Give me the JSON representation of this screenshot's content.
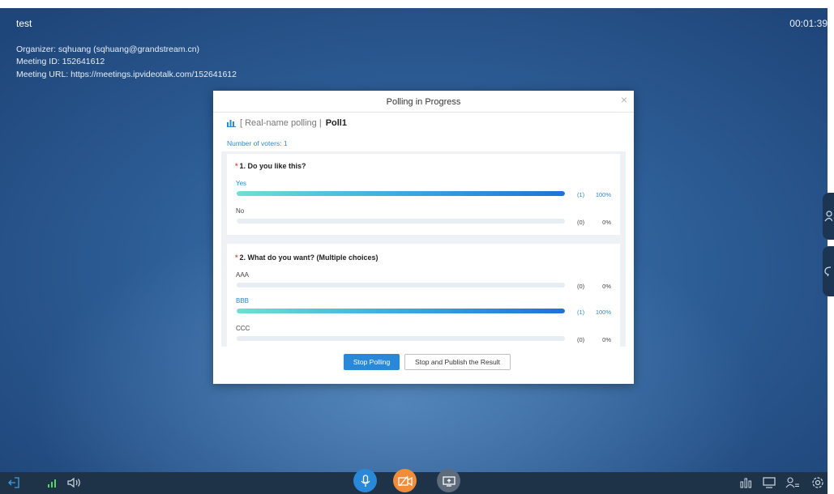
{
  "meeting": {
    "title": "test",
    "timer": "00:01:39",
    "organizer": "Organizer: sqhuang (sqhuang@grandstream.cn)",
    "meeting_id": "Meeting ID: 152641612",
    "meeting_url": "Meeting URL: https://meetings.ipvideotalk.com/152641612"
  },
  "dialog": {
    "title": "Polling in Progress",
    "close_symbol": "×",
    "poll_type": "[ Real-name polling |",
    "poll_name": "Poll1",
    "voters_text": "Number of voters: 1",
    "questions": [
      {
        "required_mark": "*",
        "title": "1. Do you like this?",
        "options": [
          {
            "label": "Yes",
            "count": "(1)",
            "percent": "100%",
            "fraction": 1.0,
            "selected": true
          },
          {
            "label": "No",
            "count": "(0)",
            "percent": "0%",
            "fraction": 0.0,
            "selected": false
          }
        ]
      },
      {
        "required_mark": "*",
        "title": "2. What do you want? (Multiple choices)",
        "options": [
          {
            "label": "AAA",
            "count": "(0)",
            "percent": "0%",
            "fraction": 0.0,
            "selected": false
          },
          {
            "label": "BBB",
            "count": "(1)",
            "percent": "100%",
            "fraction": 1.0,
            "selected": true
          },
          {
            "label": "CCC",
            "count": "(0)",
            "percent": "0%",
            "fraction": 0.0,
            "selected": false
          }
        ]
      }
    ],
    "buttons": {
      "stop": "Stop Polling",
      "publish": "Stop and Publish the Result"
    }
  },
  "toolbar": {
    "icons": [
      "leave-icon",
      "signal-icon",
      "speaker-icon",
      "microphone-icon",
      "camera-off-icon",
      "screen-share-icon",
      "poll-icon",
      "screen-layout-icon",
      "participants-icon",
      "settings-icon"
    ]
  },
  "colors": {
    "accent": "#2a88d8",
    "camera_button": "#f08c3a",
    "required": "#e94e4e",
    "toolbar_bg": "#1e3348"
  }
}
